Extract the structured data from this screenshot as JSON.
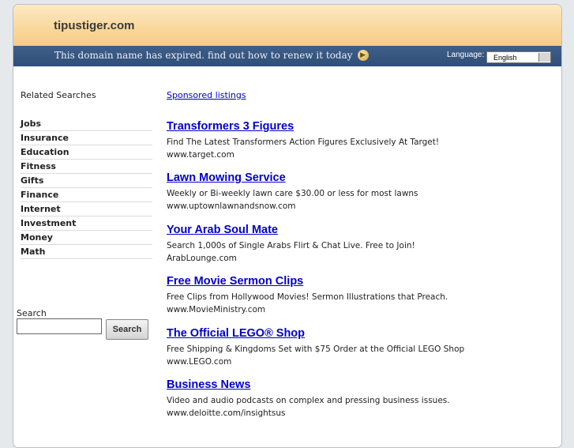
{
  "header": {
    "site_title": "tipustiger.com",
    "expired_message": "This domain name has expired. find out how to renew it today",
    "renew_icon": "arrow-circle-icon",
    "language_label": "Language:",
    "language_value": "English"
  },
  "left": {
    "related_title": "Related Searches",
    "items": [
      "Jobs",
      "Insurance",
      "Education",
      "Fitness",
      "Gifts",
      "Finance",
      "Internet",
      "Investment",
      "Money",
      "Math"
    ],
    "search_label": "Search",
    "search_value": "",
    "search_button": "Search"
  },
  "right": {
    "sponsored_label": "Sponsored listings",
    "listings": [
      {
        "title": "Transformers 3 Figures",
        "desc": "Find The Latest Transformers Action Figures Exclusively At Target!",
        "url": "www.target.com"
      },
      {
        "title": "Lawn Mowing Service",
        "desc": "Weekly or Bi-weekly lawn care $30.00 or less for most lawns",
        "url": "www.uptownlawnandsnow.com"
      },
      {
        "title": "Your Arab Soul Mate",
        "desc": "Search 1,000s of Single Arabs Flirt & Chat Live. Free to Join!",
        "url": "ArabLounge.com"
      },
      {
        "title": "Free Movie Sermon Clips",
        "desc": "Free Clips from Hollywood Movies! Sermon Illustrations that Preach.",
        "url": "www.MovieMinistry.com"
      },
      {
        "title": "The Official LEGO® Shop",
        "desc": "Free Shipping & Kingdoms Set with $75 Order at the Official LEGO Shop",
        "url": "www.LEGO.com"
      },
      {
        "title": "Business News",
        "desc": "Video and audio podcasts on complex and pressing business issues.",
        "url": "www.deloitte.com/insightsus"
      }
    ]
  }
}
